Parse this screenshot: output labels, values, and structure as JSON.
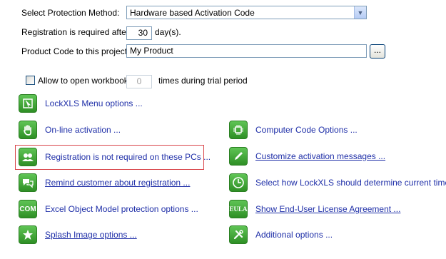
{
  "method": {
    "label": "Select Protection Method:",
    "value": "Hardware based Activation Code"
  },
  "registration": {
    "label": "Registration is required after",
    "days": "30",
    "suffix": "day(s)."
  },
  "product": {
    "label": "Product Code to this project:",
    "value": "My Product",
    "browse_label": "..."
  },
  "trial": {
    "checkbox_label": "Allow to open workbook",
    "times": "0",
    "suffix": "times during trial period"
  },
  "options_left": [
    {
      "icon": "menu-icon",
      "label": "LockXLS Menu options ...",
      "underline": false
    },
    {
      "icon": "hand-icon",
      "label": "On-line activation ...",
      "underline": false
    },
    {
      "icon": "users-icon",
      "label": "Registration is not required on these PCs ...",
      "underline": false
    },
    {
      "icon": "chat-icon",
      "label": "Remind customer about registration ...",
      "underline": true
    },
    {
      "icon": "com-icon",
      "label": "Excel Object Model protection options ...",
      "underline": false
    },
    {
      "icon": "star-icon",
      "label": "Splash Image options ...",
      "underline": true
    }
  ],
  "options_right": [
    {
      "icon": "chip-icon",
      "label": "Computer Code Options ...",
      "underline": false
    },
    {
      "icon": "pen-icon",
      "label": "Customize activation messages ...",
      "underline": true
    },
    {
      "icon": "clock-icon",
      "label": "Select how LockXLS should determine current time ...",
      "underline": false
    },
    {
      "icon": "eula-icon",
      "label": "Show End-User License Agreement ...",
      "underline": true
    },
    {
      "icon": "tools-icon",
      "label": "Additional options ...",
      "underline": false
    }
  ],
  "icon_text": {
    "com": "COM",
    "eula": "EULA"
  },
  "colors": {
    "link": "#1f2fa8",
    "icon_green": "#3fa535",
    "highlight": "#d9454a"
  }
}
